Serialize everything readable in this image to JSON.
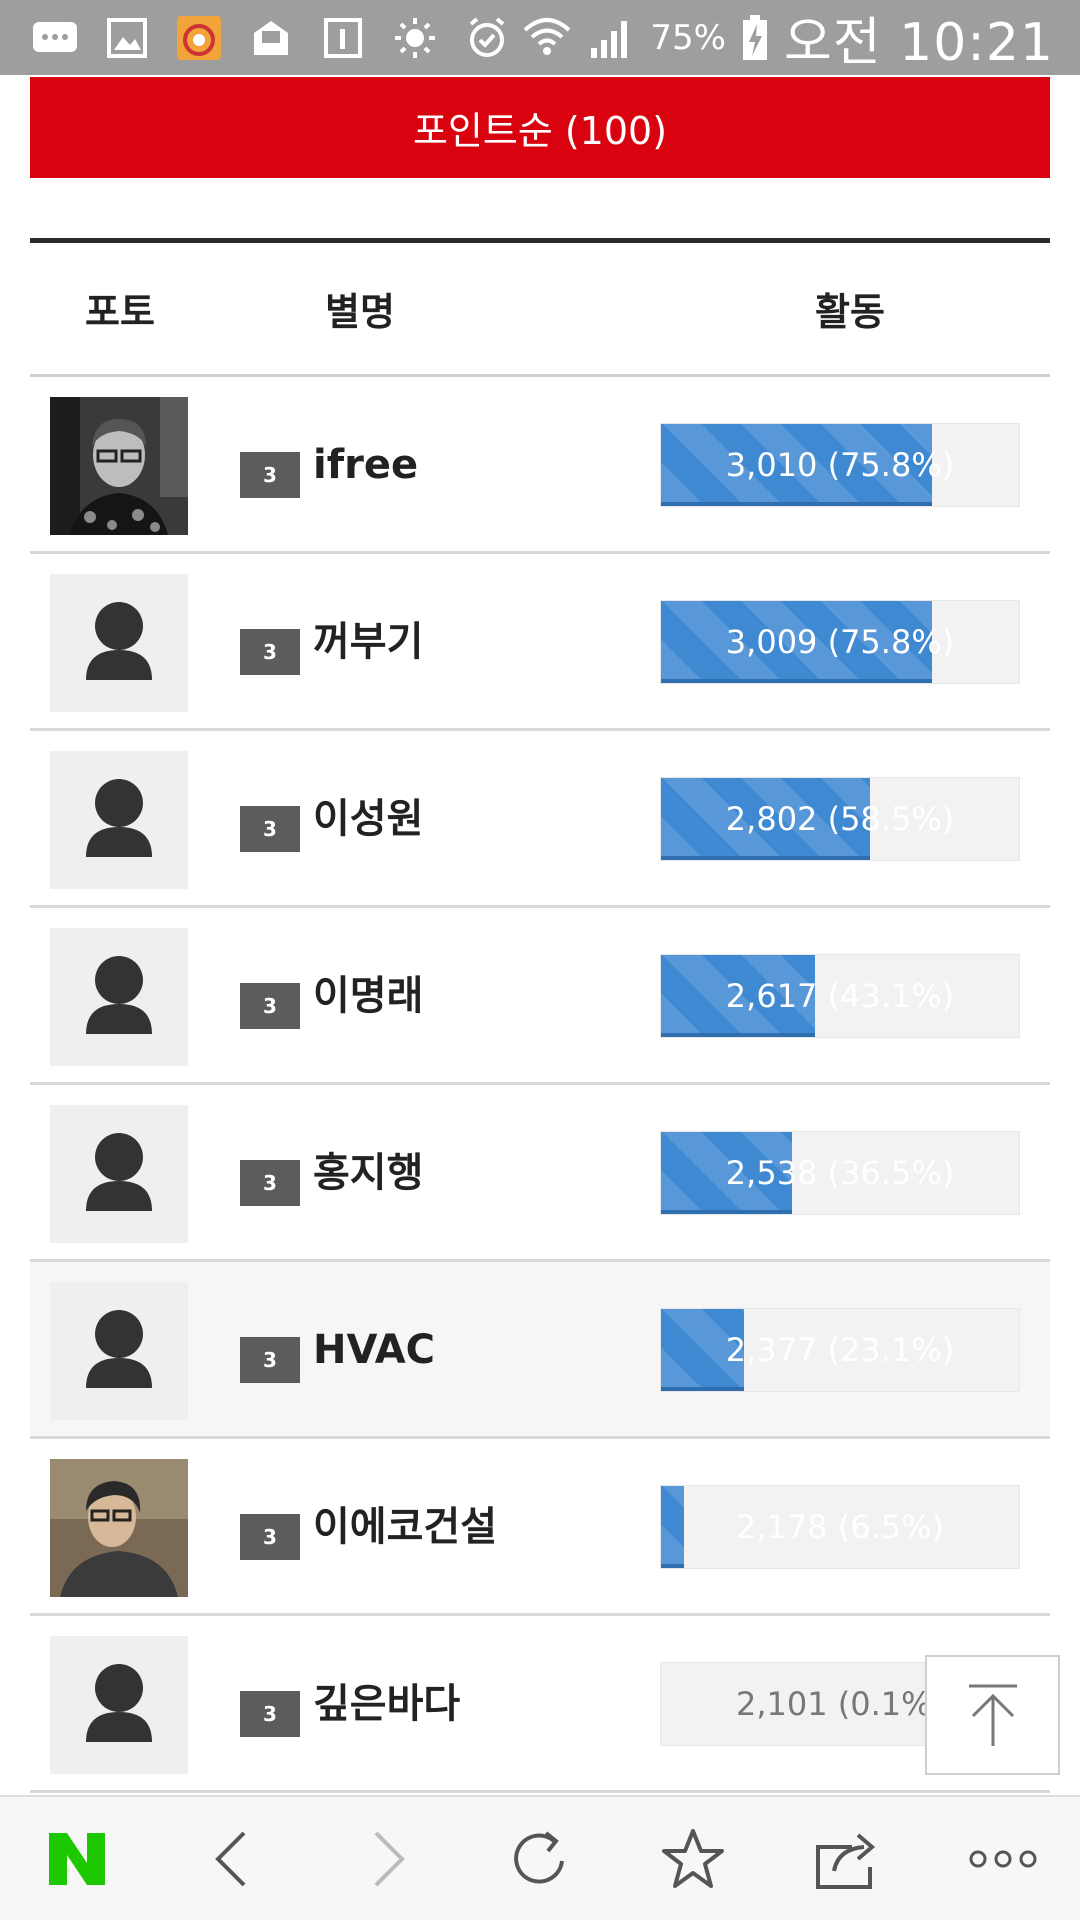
{
  "status_bar": {
    "battery_percent": "75%",
    "time": "오전 10:21",
    "icons": [
      "chat-bubble-icon",
      "gallery-icon",
      "app-icon",
      "mail-icon",
      "calendar-icon",
      "brightness-icon",
      "alarm-icon",
      "wifi-icon",
      "signal-icon",
      "battery-charging-icon"
    ]
  },
  "sort": {
    "label": "포인트순 (100)"
  },
  "table": {
    "headers": {
      "photo": "포토",
      "nickname": "별명",
      "activity": "활동"
    },
    "rows": [
      {
        "photo": "photo",
        "level": "3",
        "nickname": "ifree",
        "value_label": "3,010 (75.8%)",
        "fill": 0.758,
        "highlight": false
      },
      {
        "photo": "avatar",
        "level": "3",
        "nickname": "꺼부기",
        "value_label": "3,009 (75.8%)",
        "fill": 0.758,
        "highlight": false
      },
      {
        "photo": "avatar",
        "level": "3",
        "nickname": "이성원",
        "value_label": "2,802 (58.5%)",
        "fill": 0.585,
        "highlight": false
      },
      {
        "photo": "avatar",
        "level": "3",
        "nickname": "이명래",
        "value_label": "2,617 (43.1%)",
        "fill": 0.431,
        "highlight": false
      },
      {
        "photo": "avatar",
        "level": "3",
        "nickname": "홍지행",
        "value_label": "2,538 (36.5%)",
        "fill": 0.365,
        "highlight": false
      },
      {
        "photo": "avatar",
        "level": "3",
        "nickname": "HVAC",
        "value_label": "2,377 (23.1%)",
        "fill": 0.231,
        "highlight": true
      },
      {
        "photo": "photo",
        "level": "3",
        "nickname": "이에코건설",
        "value_label": "2,178 (6.5%)",
        "fill": 0.065,
        "highlight": false
      },
      {
        "photo": "avatar",
        "level": "3",
        "nickname": "깊은바다",
        "value_label": "2,101 (0.1%)",
        "fill": 0.001,
        "highlight": false
      }
    ]
  },
  "scroll_top": {
    "icon": "arrow-up-icon"
  },
  "browser_nav": {
    "items": [
      "naver-logo-icon",
      "back-icon",
      "forward-icon",
      "refresh-icon",
      "bookmark-star-icon",
      "share-icon",
      "more-icon"
    ],
    "logo_text": "N",
    "accent": "#1ec800"
  },
  "colors": {
    "sort_bg": "#d9020f",
    "bar_fill": "#3f89d3"
  }
}
